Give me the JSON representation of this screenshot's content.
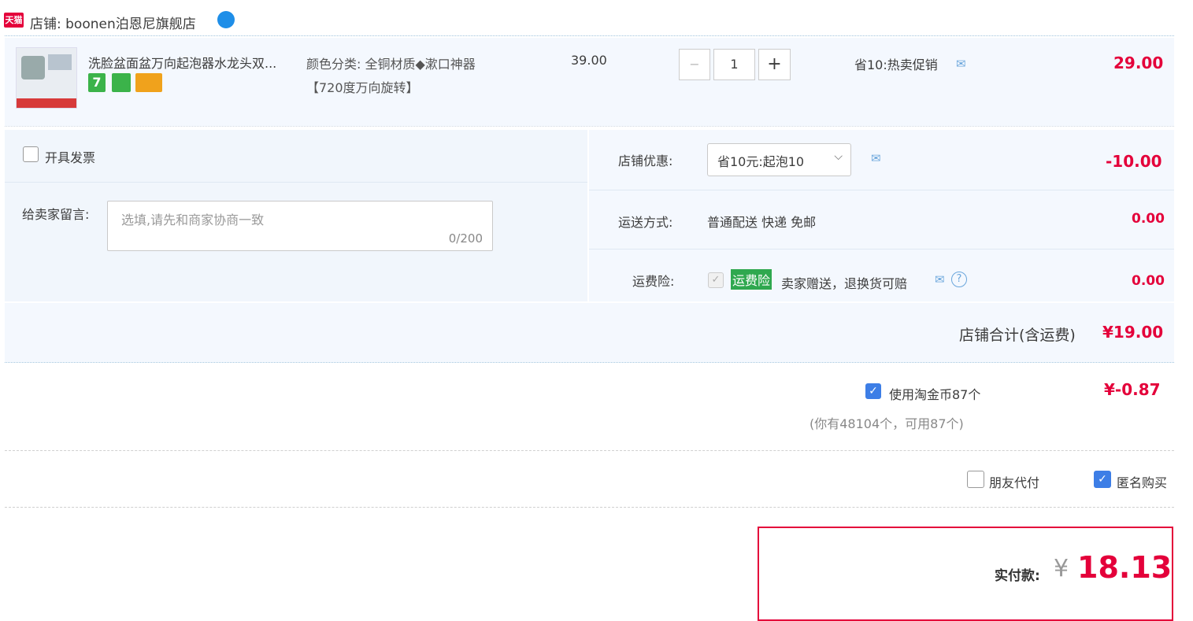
{
  "shop": {
    "badge": "天猫",
    "label": "店铺: boonen泊恩尼旗舰店"
  },
  "item": {
    "title": "洗脸盆面盆万向起泡器水龙头双...",
    "sku_line1": "颜色分类: 全铜材质◆漱口神器",
    "sku_line2": "【720度万向旋转】",
    "tag_seven": "7",
    "unit_price": "39.00",
    "qty_minus": "−",
    "qty_value": "1",
    "qty_plus": "+",
    "promo": "省10:热卖促销",
    "subtotal": "29.00"
  },
  "invoice": {
    "label": "开具发票"
  },
  "message": {
    "label": "给卖家留言:",
    "placeholder": "选填,请先和商家协商一致",
    "counter": "0/200"
  },
  "discount": {
    "label": "店铺优惠:",
    "selected": "省10元:起泡10",
    "value": "-10.00"
  },
  "shipping": {
    "label": "运送方式:",
    "method": "普通配送 快递 免邮",
    "value": "0.00"
  },
  "insurance": {
    "label": "运费险:",
    "badge": "运费险",
    "text": "卖家赠送，退换货可赔",
    "value": "0.00"
  },
  "shop_total": {
    "label": "店铺合计(含运费)",
    "value": "¥19.00"
  },
  "coins": {
    "label": "使用淘金币87个",
    "note": "(你有48104个，可用87个)",
    "value": "¥-0.87"
  },
  "options": {
    "friend_pay": "朋友代付",
    "anonymous": "匿名购买"
  },
  "payment": {
    "label": "实付款:",
    "currency": "¥",
    "amount": "18.13"
  },
  "colors": {
    "accent_red": "#e4003a",
    "link_blue": "#3d7ee6",
    "panel_bg": "#f4f8fe"
  }
}
